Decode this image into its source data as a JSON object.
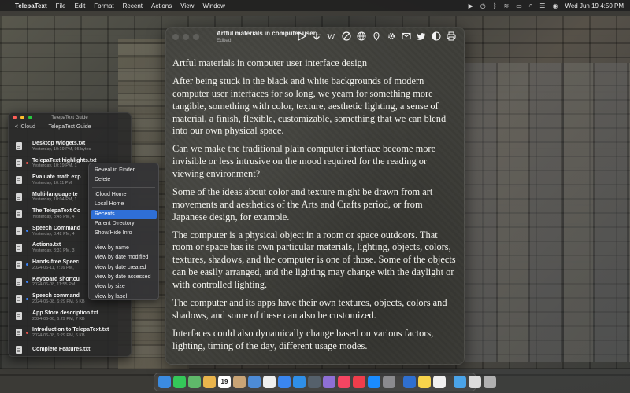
{
  "menubar": {
    "app_name": "TelepaText",
    "menus": [
      "File",
      "Edit",
      "Format",
      "Recent",
      "Actions",
      "View",
      "Window"
    ],
    "datetime": "Wed Jun 19  4:50 PM"
  },
  "window": {
    "title": "Artful materials in computer user...",
    "subtitle": "Edited"
  },
  "document": {
    "paragraphs": [
      "Artful materials in computer user interface design",
      "After being stuck in the black and white backgrounds of modern computer user interfaces for so long, we yearn for something more tangible, something with color, texture, aesthetic lighting, a sense of material, a finish, flexible, customizable, something that we can blend into our own physical space.",
      "Can we make the traditional plain computer interface become more invisible or less intrusive on the mood required for the reading or viewing environment?",
      "Some of the ideas about color and texture might be drawn from art movements and aesthetics of the Arts and Crafts period, or from Japanese design, for example.",
      "The computer is a physical object in a room or space outdoors. That room or space has its own particular materials, lighting, objects, colors, textures, shadows, and the computer is one of those. Some of the objects can be easily arranged, and the lighting may change with the daylight or with controlled lighting.",
      "The computer and its apps have their own textures, objects, colors and shadows, and some of these can also be customized.",
      "Interfaces could also dynamically change based on various factors, lighting, timing of the day, different usage modes."
    ]
  },
  "guide": {
    "window_title": "TelepaText Guide",
    "back_label": "< iCloud",
    "nav_title": "TelepaText Guide",
    "files": [
      {
        "name": "Desktop Widgets.txt",
        "meta": "Yesterday, 10:19 PM, 95 bytes",
        "dot": ""
      },
      {
        "name": "TelepaText highlights.txt",
        "meta": "Yesterday, 10:19 PM, 1",
        "dot": "#e0524b"
      },
      {
        "name": "Evaluate math exp",
        "meta": "Yesterday, 10:11 PM",
        "dot": ""
      },
      {
        "name": "Multi-language te",
        "meta": "Yesterday, 10:04 PM, 1",
        "dot": ""
      },
      {
        "name": "The TelepaText Co",
        "meta": "Yesterday, 8:45 PM, 4",
        "dot": ""
      },
      {
        "name": "Speech Command",
        "meta": "Yesterday, 8:42 PM, 4",
        "dot": "#3b82f6"
      },
      {
        "name": "Actions.txt",
        "meta": "Yesterday, 8:31 PM, 3",
        "dot": ""
      },
      {
        "name": "Hands-free Speec",
        "meta": "2024-06-11, 7:16 PM,",
        "dot": "#3b82f6"
      },
      {
        "name": "Keyboard shortcu",
        "meta": "2024-06-08, 11:55 PM",
        "dot": "#3b82f6"
      },
      {
        "name": "Speech command",
        "meta": "2024-06-08, 6:29 PM, 5 KB",
        "dot": "#3b82f6"
      },
      {
        "name": "App Store description.txt",
        "meta": "2024-06-08, 6:29 PM, 7 KB",
        "dot": ""
      },
      {
        "name": "Introduction to TelepaText.txt",
        "meta": "2024-06-08, 6:29 PM, 6 KB",
        "dot": "#e0524b"
      },
      {
        "name": "Complete Features.txt",
        "meta": "",
        "dot": ""
      }
    ]
  },
  "context_menu": {
    "groups": [
      [
        "Reveal in Finder",
        "Delete"
      ],
      [
        "iCloud Home",
        "Local Home",
        "Recents",
        "Parent Directory",
        "Show/Hide Info"
      ],
      [
        "View by name",
        "View by date modified",
        "View by date created",
        "View by date accessed",
        "View by size",
        "View by label"
      ]
    ],
    "selected": "Recents"
  },
  "dock": {
    "apps": [
      {
        "name": "finder",
        "color": "#3b8be0"
      },
      {
        "name": "messages",
        "color": "#34c759"
      },
      {
        "name": "maps",
        "color": "#5fb86a"
      },
      {
        "name": "photos",
        "color": "#e9b44c"
      },
      {
        "name": "calendar",
        "color": "#ffffff",
        "label": "19"
      },
      {
        "name": "contacts",
        "color": "#c9a476"
      },
      {
        "name": "preview",
        "color": "#4d8bd6"
      },
      {
        "name": "textedit",
        "color": "#eeeeee"
      },
      {
        "name": "mail",
        "color": "#3a86f0"
      },
      {
        "name": "safari",
        "color": "#2f8fe8"
      },
      {
        "name": "telepatext",
        "color": "#55606b"
      },
      {
        "name": "notes",
        "color": "#8e6fd6"
      },
      {
        "name": "music",
        "color": "#f54562"
      },
      {
        "name": "news",
        "color": "#ef3d4b"
      },
      {
        "name": "app-store",
        "color": "#1a8cff"
      },
      {
        "name": "settings",
        "color": "#8a8a8e"
      },
      {
        "name": "separator"
      },
      {
        "name": "quicktime",
        "color": "#2f6fcf"
      },
      {
        "name": "stickies",
        "color": "#f7d34b"
      },
      {
        "name": "pages",
        "color": "#f0f0f0"
      },
      {
        "name": "separator"
      },
      {
        "name": "downloads",
        "color": "#4aa3e8"
      },
      {
        "name": "screenshot",
        "color": "#dddddd"
      },
      {
        "name": "trash",
        "color": "#b0b0b0"
      }
    ]
  },
  "colors": {
    "selection": "#2f6fd6",
    "label_red": "#e0524b",
    "label_blue": "#3b82f6"
  },
  "icons": {
    "toolbar": [
      "play-icon",
      "download-icon",
      "wikipedia-icon",
      "block-icon",
      "globe-icon",
      "location-pin-icon",
      "gear-icon",
      "mail-icon",
      "twitter-icon",
      "contrast-icon",
      "print-icon"
    ]
  }
}
